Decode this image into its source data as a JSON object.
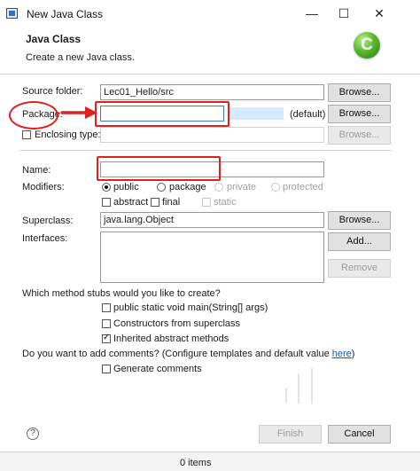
{
  "window": {
    "title": "New Java Class",
    "controls": {
      "minimize": "—",
      "maximize": "☐",
      "close": "✕"
    }
  },
  "header": {
    "title": "Java Class",
    "description": "Create a new Java class.",
    "logo_letter": "C"
  },
  "form": {
    "source_folder": {
      "label": "Source folder:",
      "value": "Lec01_Hello/src",
      "button": "Browse..."
    },
    "package": {
      "label": "Package:",
      "value": "",
      "default_text": "(default)",
      "button": "Browse..."
    },
    "enclosing_type": {
      "label": "Enclosing type:",
      "value": "",
      "button": "Browse...",
      "checked": false
    },
    "name": {
      "label": "Name:",
      "value": ""
    },
    "modifiers": {
      "label": "Modifiers:",
      "visibility": [
        "public",
        "package",
        "private",
        "protected"
      ],
      "selected": "public",
      "flags": [
        "abstract",
        "final",
        "static"
      ]
    },
    "superclass": {
      "label": "Superclass:",
      "value": "java.lang.Object",
      "button": "Browse..."
    },
    "interfaces": {
      "label": "Interfaces:",
      "add_button": "Add...",
      "remove_button": "Remove"
    },
    "stubs": {
      "question": "Which method stubs would you like to create?",
      "options": [
        {
          "label": "public static void main(String[] args)",
          "checked": false
        },
        {
          "label": "Constructors from superclass",
          "checked": false
        },
        {
          "label": "Inherited abstract methods",
          "checked": true
        }
      ]
    },
    "comments": {
      "question": "Do you want to add comments? (Configure templates and default value ",
      "link": "here",
      "question_end": ")",
      "option": "Generate comments",
      "checked": false
    }
  },
  "footer": {
    "help": "?",
    "finish": "Finish",
    "cancel": "Cancel"
  },
  "status_bar": {
    "text": "0 items"
  },
  "colors": {
    "annotation": "#e0201c",
    "accent": "#3b6fc6",
    "logo": "#59b82e"
  },
  "icons": [
    "java-window-icon",
    "new-class-logo-icon",
    "help-icon",
    "red-arrow-icon"
  ]
}
